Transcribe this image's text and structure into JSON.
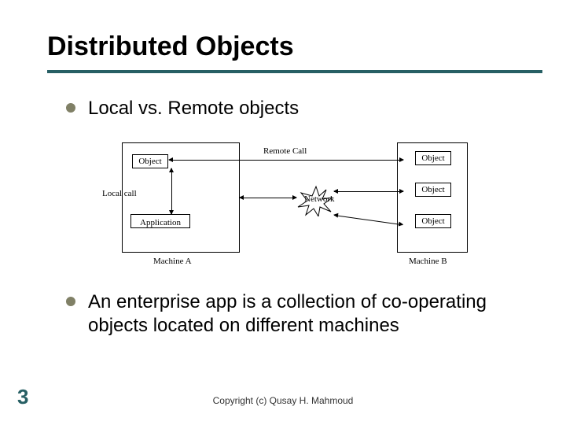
{
  "slide": {
    "title": "Distributed Objects",
    "page_number": "3",
    "footer": "Copyright (c) Qusay H. Mahmoud"
  },
  "bullets": [
    "Local vs. Remote objects",
    "An enterprise app is a collection of co-operating objects located on different machines"
  ],
  "diagram": {
    "machine_a_label": "Machine A",
    "machine_b_label": "Machine B",
    "object_label": "Object",
    "application_label": "Application",
    "local_call_label": "Local call",
    "remote_call_label": "Remote Call",
    "network_label": "Network"
  }
}
